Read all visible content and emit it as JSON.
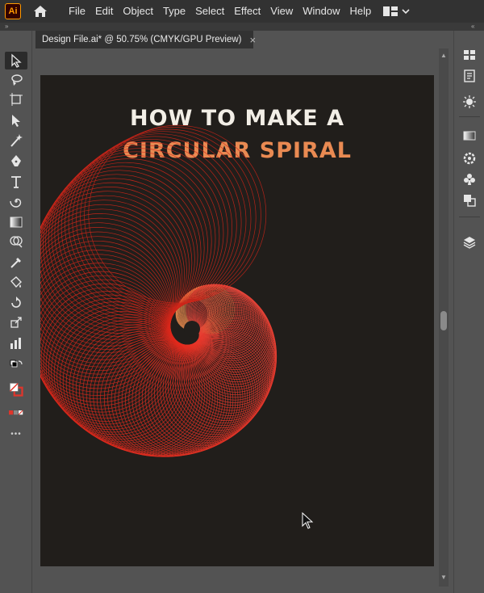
{
  "app": {
    "logo": "Ai"
  },
  "menu": [
    "File",
    "Edit",
    "Object",
    "Type",
    "Select",
    "Effect",
    "View",
    "Window",
    "Help"
  ],
  "document_tab": {
    "label": "Design File.ai* @ 50.75% (CMYK/GPU Preview)",
    "close": "×"
  },
  "artboard": {
    "title_line1": "HOW TO MAKE A",
    "title_line2": "CIRCULAR SPIRAL"
  },
  "toolbar": {
    "more": "•••"
  },
  "colors": {
    "title_accent": "#e98a52",
    "spiral": "#e94a40",
    "artboard": "#211e1b"
  }
}
